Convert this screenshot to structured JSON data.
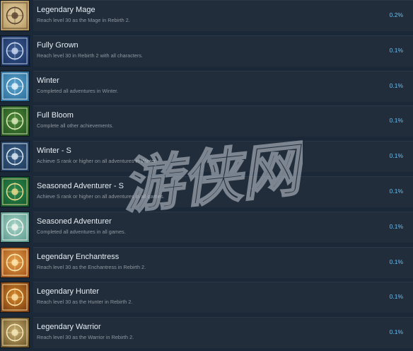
{
  "achievements": [
    {
      "title": "Legendary Mage",
      "desc": "Reach level 30 as the Mage in Rebirth 2.",
      "pct": "0.2%",
      "icon": "mage-emblem-icon",
      "colors": [
        "#e6d3a8",
        "#b79a62",
        "#5a4430"
      ]
    },
    {
      "title": "Fully Grown",
      "desc": "Reach level 30 in Rebirth 2 with all characters.",
      "pct": "0.1%",
      "icon": "grown-emblem-icon",
      "colors": [
        "#3d5d94",
        "#18305e",
        "#c8d6ee"
      ]
    },
    {
      "title": "Winter",
      "desc": "Completed all adventures in Winter.",
      "pct": "0.1%",
      "icon": "snowflake-icon",
      "colors": [
        "#5aa4cf",
        "#2d6f9a",
        "#e8f4fb"
      ]
    },
    {
      "title": "Full Bloom",
      "desc": "Complete all other achievements.",
      "pct": "0.1%",
      "icon": "tree-icon",
      "colors": [
        "#4f8a3a",
        "#23531f",
        "#d9e9b8"
      ]
    },
    {
      "title": "Winter - S",
      "desc": "Achieve S rank or higher on all adventures in Winter.",
      "pct": "0.1%",
      "icon": "snowflake-s-icon",
      "colors": [
        "#3a5f86",
        "#1f3a5c",
        "#dbe8f2"
      ]
    },
    {
      "title": "Seasoned Adventurer - S",
      "desc": "Achieve S rank or higher on all adventures in all games.",
      "pct": "0.1%",
      "icon": "seasoned-s-icon",
      "colors": [
        "#2f8a4f",
        "#145a2f",
        "#e9d98b"
      ]
    },
    {
      "title": "Seasoned Adventurer",
      "desc": "Completed all adventures in all games.",
      "pct": "0.1%",
      "icon": "seasoned-icon",
      "colors": [
        "#a8d4c8",
        "#5e9c90",
        "#f0f6ee"
      ]
    },
    {
      "title": "Legendary Enchantress",
      "desc": "Reach level 30 as the Enchantress in Rebirth 2.",
      "pct": "0.1%",
      "icon": "enchantress-emblem-icon",
      "colors": [
        "#e6a24a",
        "#a3531a",
        "#fde8b0"
      ]
    },
    {
      "title": "Legendary Hunter",
      "desc": "Reach level 30 as the Hunter in Rebirth 2.",
      "pct": "0.1%",
      "icon": "hunter-emblem-icon",
      "colors": [
        "#d98b2c",
        "#7a3d12",
        "#fbe1a6"
      ]
    },
    {
      "title": "Legendary Warrior",
      "desc": "Reach level 30 as the Warrior in Rebirth 2.",
      "pct": "0.1%",
      "icon": "warrior-emblem-icon",
      "colors": [
        "#c9b074",
        "#6d5526",
        "#f5e6b8"
      ]
    }
  ],
  "watermark": {
    "text": "游侠网",
    "color": "#c7ced6"
  }
}
